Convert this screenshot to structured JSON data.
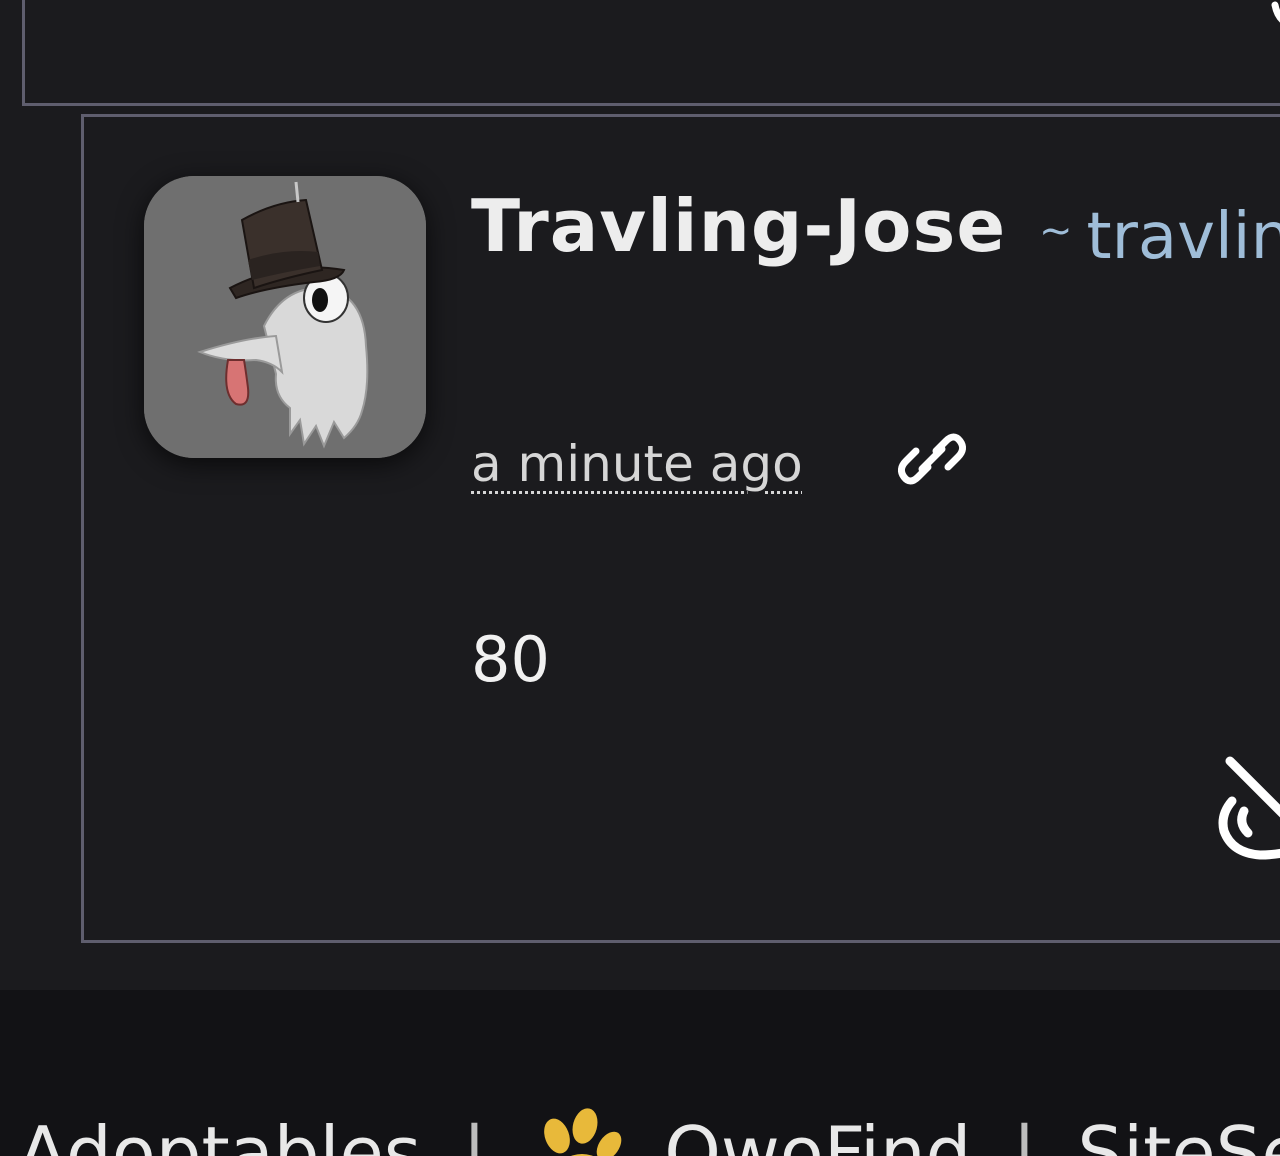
{
  "comment": {
    "display_name": "Travling-Jose",
    "handle_prefix": "~",
    "handle": "travlin",
    "timestamp": "a minute ago",
    "body": "80"
  },
  "footer": {
    "left_text": "Adoptables",
    "separator": "|",
    "center_text": "OwoFind",
    "right_text": "SiteSearch"
  },
  "colors": {
    "background": "#1b1b1e",
    "border": "#5f5e6e",
    "handle": "#9fbdd8",
    "footer_background": "#121215"
  },
  "icons": {
    "permalink": "link-icon",
    "action": "hide-icon",
    "footer_logo": "paw-icon"
  }
}
